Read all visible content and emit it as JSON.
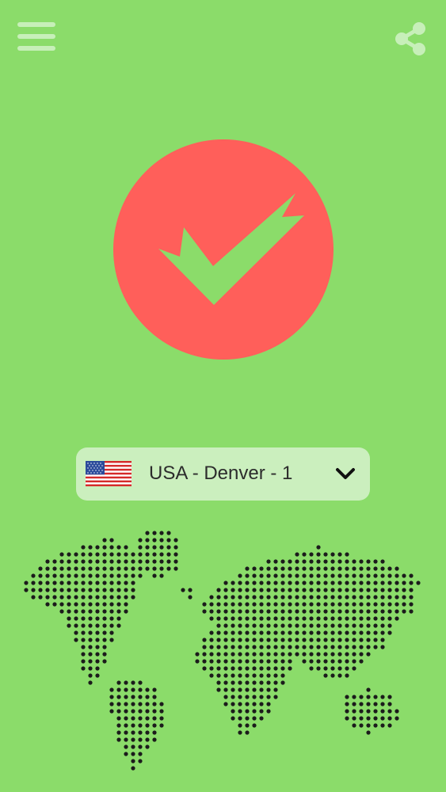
{
  "header": {
    "menu_icon": "hamburger-menu-icon",
    "share_icon": "share-icon"
  },
  "connect": {
    "icon": "checkmark-icon",
    "button_color": "#ff5f5a",
    "check_color": "#8bdc6a"
  },
  "server": {
    "flag_icon": "us-flag-icon",
    "label": "USA - Denver - 1",
    "dropdown_icon": "chevron-down-icon"
  },
  "map": {
    "icon": "dotted-world-map",
    "dot_color": "#1b1b1b"
  },
  "colors": {
    "background": "#8bdc6a",
    "light_accent": "#c7efb9",
    "selector_background": "#cbefbe"
  }
}
